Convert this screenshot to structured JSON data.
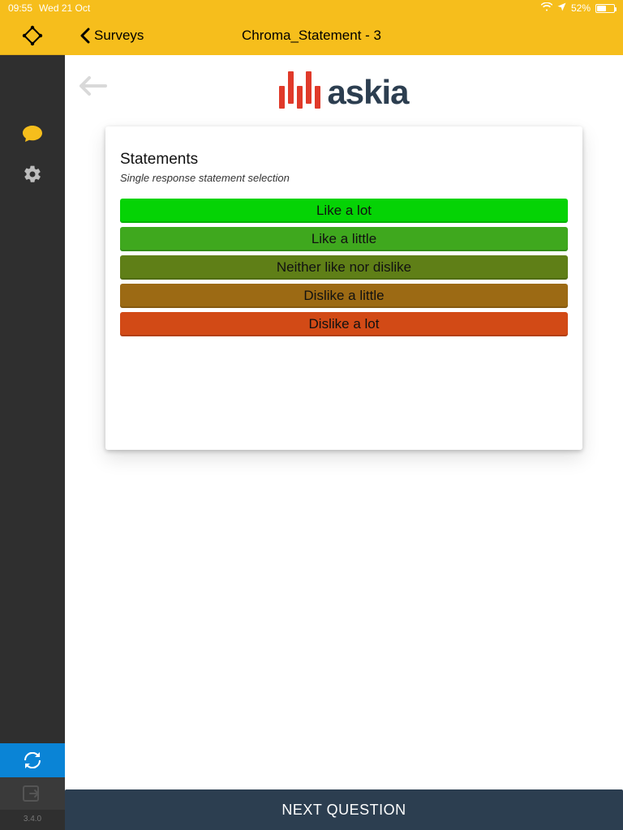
{
  "status": {
    "time": "09:55",
    "date": "Wed 21 Oct",
    "battery_pct": "52%"
  },
  "header": {
    "back_label": "Surveys",
    "title": "Chroma_Statement - 3"
  },
  "sidebar": {
    "version": "3.4.0"
  },
  "logo": {
    "word": "askia"
  },
  "question": {
    "title": "Statements",
    "subtitle": "Single response statement selection",
    "options": [
      {
        "label": "Like a lot",
        "color": "#05d305"
      },
      {
        "label": "Like a little",
        "color": "#3fa81e"
      },
      {
        "label": "Neither like nor dislike",
        "color": "#5f7f17"
      },
      {
        "label": "Dislike a little",
        "color": "#9c6a14"
      },
      {
        "label": "Dislike a lot",
        "color": "#d24a16"
      }
    ]
  },
  "footer": {
    "next_label": "NEXT QUESTION"
  }
}
